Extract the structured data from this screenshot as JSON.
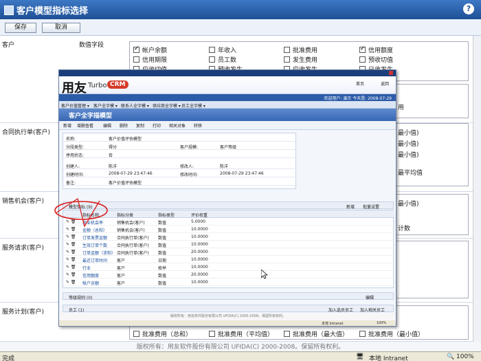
{
  "window": {
    "title": "客户模型指标选择",
    "help_label": "?"
  },
  "toolbar": {
    "save_label": "保存",
    "cancel_label": "取消"
  },
  "rows": [
    {
      "label": "客户",
      "sub": "数值字段"
    },
    {
      "label": "合同执行单(客户)",
      "sub": ""
    },
    {
      "label": "销售机会(客户)",
      "sub": ""
    },
    {
      "label": "服务请求(客户)",
      "sub": ""
    },
    {
      "label": "服务计划(客户)",
      "sub": ""
    }
  ],
  "customer_fields": [
    {
      "label": "帐户余额",
      "checked": true
    },
    {
      "label": "年收入",
      "checked": false
    },
    {
      "label": "批准费用",
      "checked": false
    },
    {
      "label": "信用额度",
      "checked": true
    },
    {
      "label": "信用期限",
      "checked": false
    },
    {
      "label": "员工数",
      "checked": false
    },
    {
      "label": "发生费用",
      "checked": false
    },
    {
      "label": "预收切值",
      "checked": false
    },
    {
      "label": "应收切值",
      "checked": false
    },
    {
      "label": "预收发生",
      "checked": false
    },
    {
      "label": "应收发生",
      "checked": false
    },
    {
      "label": "已收发生",
      "checked": false
    }
  ],
  "right_fragments": [
    "用",
    "最小值)",
    "最小值)",
    "最小值)",
    "最平均值",
    "最小值)",
    "计数"
  ],
  "service_plan_fields": [
    {
      "label": "批准费用（总和）"
    },
    {
      "label": "批准费用（平均值）"
    },
    {
      "label": "批准费用（最大值）"
    },
    {
      "label": "批准费用（最小值）"
    }
  ],
  "footer": "版权所有：用友软件股份有限公司 UFIDA(C) 2000-2008。保留所有权利。",
  "statusbar": {
    "left": "完成",
    "zone": "本地 Intranet",
    "zoom": "100%"
  },
  "popup": {
    "brand_main": "用友",
    "brand_sub": "Turbo",
    "brand_badge": "CRM",
    "nav_home": "首页",
    "nav_back": "返回",
    "nav_user": "欢迎用户: 演示  今天是: 2008-07-29",
    "menu": [
      "客户价值管理 ▾",
      "客户全字模 ▾",
      "联系人全字模 ▾",
      "供应商全字模 ▾",
      "员工全字模 ▾"
    ],
    "page_title": "客户全字描模型",
    "tools": [
      "新增",
      "增删查看",
      "编辑",
      "删除",
      "复制",
      "打印",
      "相关对象",
      "转移"
    ],
    "form": [
      {
        "k1": "名称:",
        "v1": "客户价值评估模型",
        "k2": "",
        "v2": ""
      },
      {
        "k1": "分段类型:",
        "v1": "得分",
        "k2": "客户规模:",
        "v2": "客户等级"
      },
      {
        "k1": "停用状态:",
        "v1": "否",
        "k2": "",
        "v2": ""
      },
      {
        "k1": "创建人:",
        "v1": "陈洋",
        "k2": "修改人:",
        "v2": "陈洋"
      },
      {
        "k1": "创建时间:",
        "v1": "2008-07-29 23:47:46",
        "k2": "修改时间:",
        "v2": "2008-07-29 23:47:46"
      },
      {
        "k1": "备注:",
        "v1": "客户价值评估模型",
        "k2": "",
        "v2": ""
      }
    ],
    "grid_title": "模型指标 (9)",
    "grid_actions": [
      "新增",
      "批量设置"
    ],
    "grid_headers": [
      "指标名称",
      "指标分类",
      "指标类型",
      "评价权重"
    ],
    "grid_rows": [
      [
        "商业机会率",
        "销售机会(客户)",
        "数值",
        "5.0000"
      ],
      [
        "金额（总和）",
        "销售机会(客户)",
        "数值",
        "10.0000"
      ],
      [
        "订单发票金额",
        "合同执行单(客户)",
        "数值",
        "10.0000"
      ],
      [
        "生效订单个数",
        "合同执行单(客户)",
        "数值",
        "10.0000"
      ],
      [
        "订单金额（求和）",
        "合同执行单(客户)",
        "数值",
        "20.0000"
      ],
      [
        "最近订单时间",
        "客户",
        "日期",
        "10.0000"
      ],
      [
        "行业",
        "客户",
        "枚举",
        "10.0000"
      ],
      [
        "信用额度",
        "客户",
        "数值",
        "20.0000"
      ],
      [
        "帐户余额",
        "客户",
        "数值",
        "10.0000"
      ]
    ],
    "sec2_title": "等级规则 (0)",
    "sec2_action": "编辑",
    "sec3_title": "员工 (1)",
    "sec3_actions": [
      "加入选员员工",
      "加入相关员工"
    ],
    "footer": "版权所有：用友软件股份有限公司 UFIDA(C) 2000-2008。保留所有权利。",
    "status_zone": "本地 Intranet",
    "status_zoom": "100%"
  },
  "colors": {
    "header": "#2a5ea8",
    "annotation": "#d81e1e"
  }
}
